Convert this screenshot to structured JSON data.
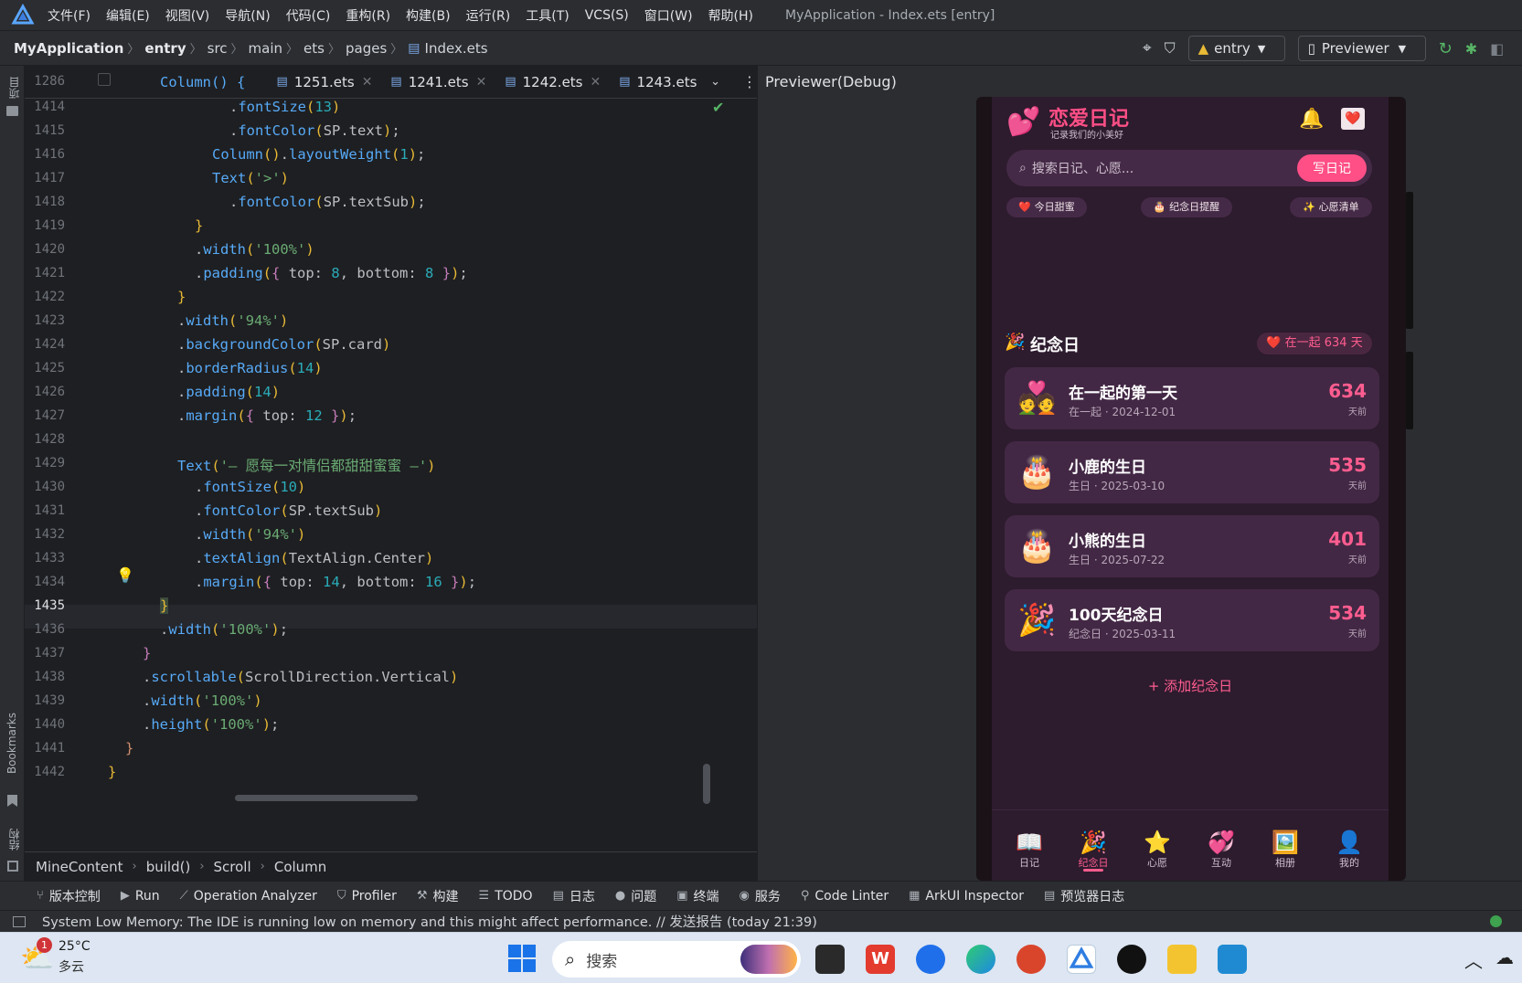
{
  "menu": {
    "items": [
      "文件(F)",
      "编辑(E)",
      "视图(V)",
      "导航(N)",
      "代码(C)",
      "重构(R)",
      "构建(B)",
      "运行(R)",
      "工具(T)",
      "VCS(S)",
      "窗口(W)",
      "帮助(H)"
    ],
    "window_title": "MyApplication - Index.ets [entry]"
  },
  "breadcrumbs": [
    "MyApplication",
    "entry",
    "src",
    "main",
    "ets",
    "pages"
  ],
  "breadcrumb_file": "Index.ets",
  "toolbar": {
    "module": "entry",
    "previewer": "Previewer"
  },
  "left_stripe": {
    "project": "项目",
    "bookmarks": "Bookmarks",
    "structure": "结构"
  },
  "editor": {
    "tabs": [
      "1251.ets",
      "1241.ets",
      "1242.ets",
      "1243.ets"
    ],
    "sticky_line": "1286",
    "sticky_code": "Column() {",
    "current_line": "1435"
  },
  "code_breadcrumb": [
    "MineContent",
    "build()",
    "Scroll",
    "Column"
  ],
  "tool_windows": [
    "版本控制",
    "Run",
    "Operation Analyzer",
    "Profiler",
    "构建",
    "TODO",
    "日志",
    "问题",
    "终端",
    "服务",
    "Code Linter",
    "ArkUI Inspector",
    "预览器日志"
  ],
  "status": {
    "message": "System Low Memory: The IDE is running low on memory and this might affect performance. // 发送报告 (today 21:39)"
  },
  "previewer": {
    "title": "Previewer(Debug)",
    "app": {
      "title": "恋爱日记",
      "subtitle": "记录我们的小美好",
      "search_placeholder": "搜索日记、心愿...",
      "write_button": "写日记",
      "chips": [
        "❤️ 今日甜蜜",
        "🎂 纪念日提醒",
        "✨ 心愿清单"
      ],
      "section_title": "纪念日",
      "together_badge": "❤️ 在一起 634 天",
      "anniversaries": [
        {
          "emoji": "💑",
          "title": "在一起的第一天",
          "sub": "在一起 · 2024-12-01",
          "days": "634",
          "unit": "天前"
        },
        {
          "emoji": "🎂",
          "title": "小鹿的生日",
          "sub": "生日 · 2025-03-10",
          "days": "535",
          "unit": "天前"
        },
        {
          "emoji": "🎂",
          "title": "小熊的生日",
          "sub": "生日 · 2025-07-22",
          "days": "401",
          "unit": "天前"
        },
        {
          "emoji": "🎉",
          "title": "100天纪念日",
          "sub": "纪念日 · 2025-03-11",
          "days": "534",
          "unit": "天前"
        }
      ],
      "add_label": "+  添加纪念日",
      "nav": [
        {
          "icon": "📖",
          "label": "日记"
        },
        {
          "icon": "🎉",
          "label": "纪念日"
        },
        {
          "icon": "⭐",
          "label": "心愿"
        },
        {
          "icon": "💞",
          "label": "互动"
        },
        {
          "icon": "🖼️",
          "label": "相册"
        },
        {
          "icon": "👤",
          "label": "我的"
        }
      ]
    }
  },
  "taskbar": {
    "weather_temp": "25°C",
    "weather_desc": "多云",
    "badge": "1",
    "search": "搜索"
  },
  "colors": {
    "accent_pink": "#ff4f86",
    "app_bg": "#2d1b2e",
    "card_bg": "#432845",
    "ide_bg": "#1e1f22"
  }
}
